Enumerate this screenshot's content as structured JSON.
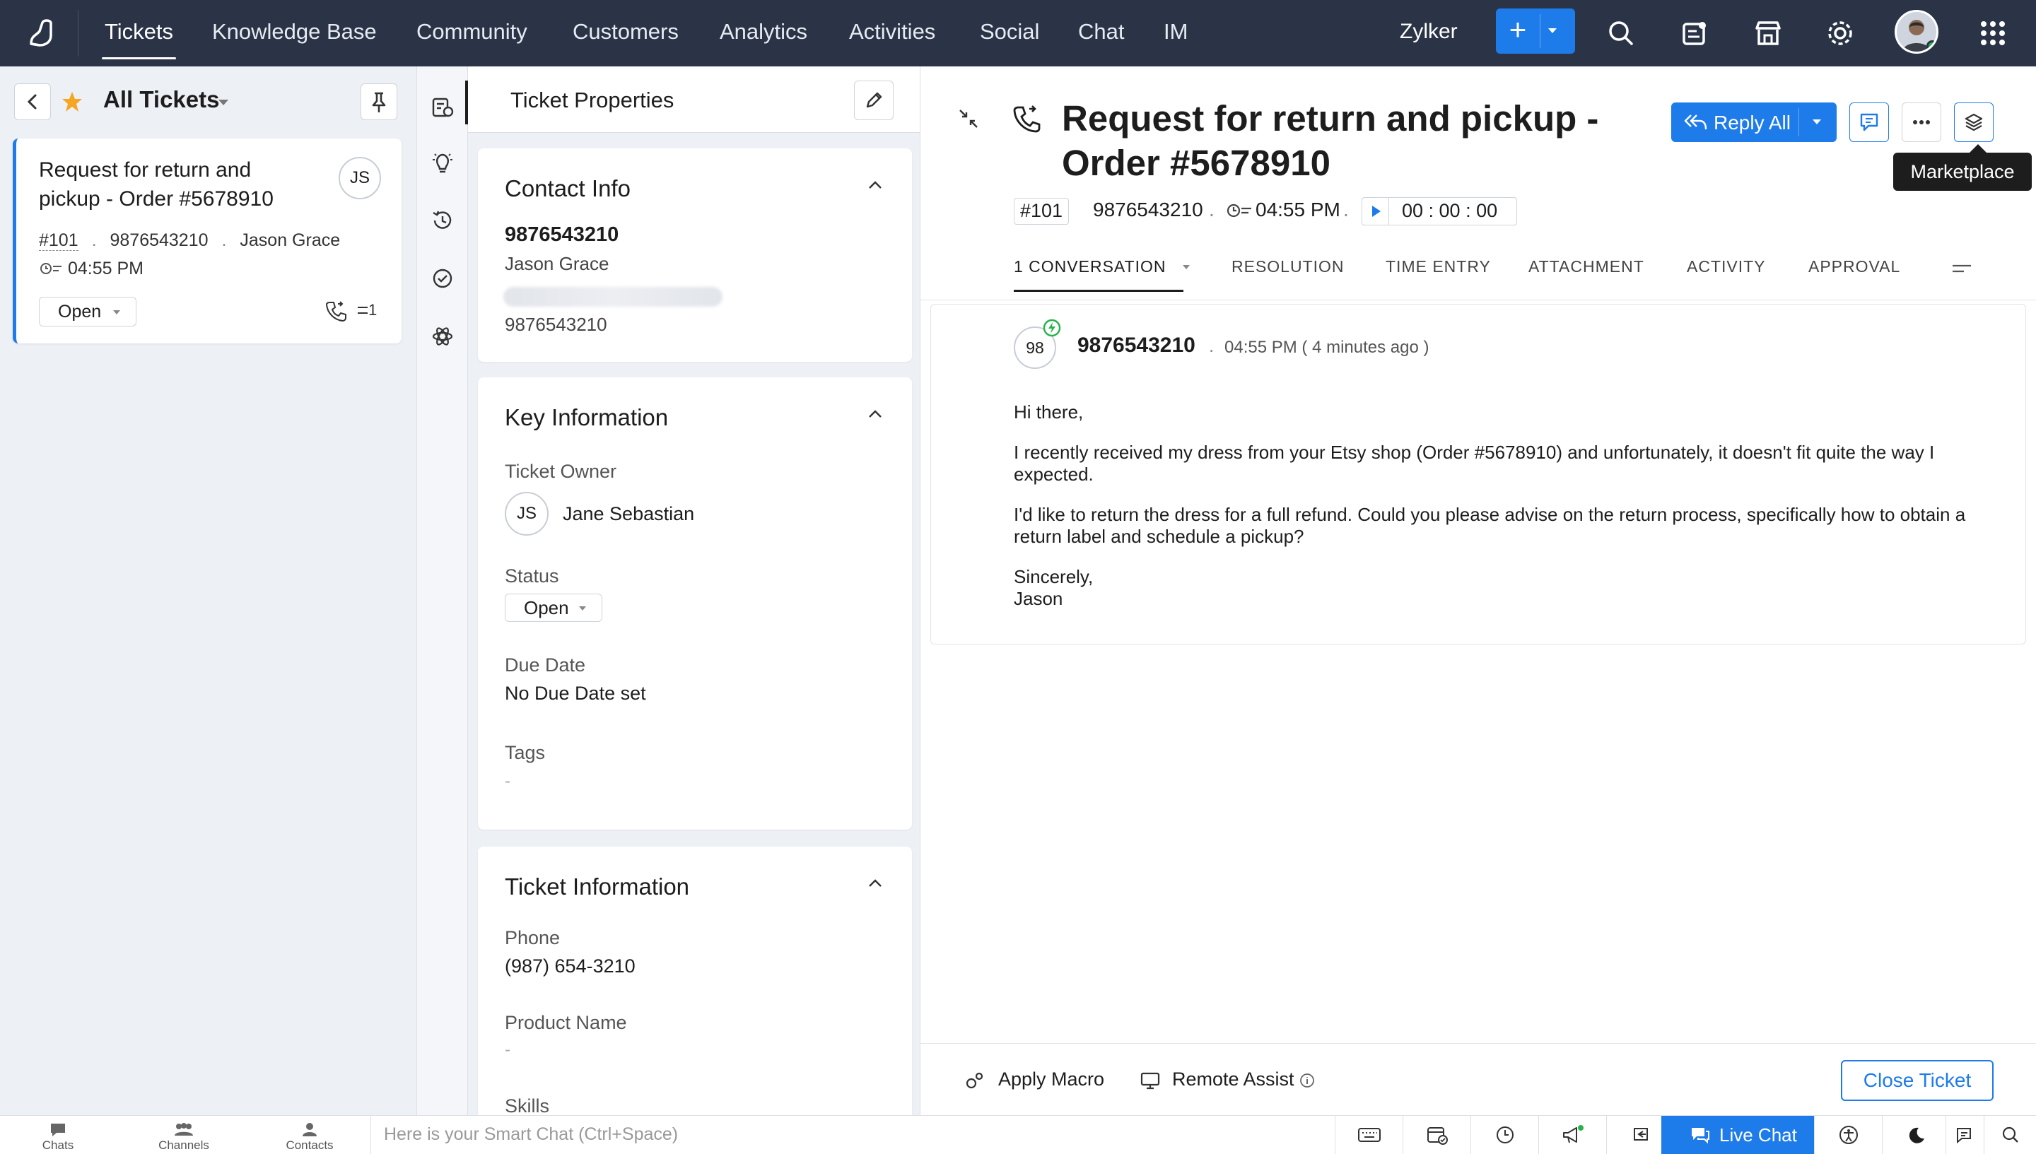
{
  "topnav": {
    "tabs": [
      "Tickets",
      "Knowledge Base",
      "Community",
      "Customers",
      "Analytics",
      "Activities",
      "Social",
      "Chat",
      "IM"
    ],
    "active": "Tickets",
    "org": "Zylker"
  },
  "leftpanel": {
    "view_title": "All Tickets",
    "card": {
      "subject": "Request for return and pickup - Order #5678910",
      "avatar": "JS",
      "id": "#101",
      "phone": "9876543210",
      "contact": "Jason Grace",
      "time": "04:55 PM",
      "status": "Open",
      "thread_count": "1"
    }
  },
  "props": {
    "title": "Ticket Properties",
    "contact_info": {
      "heading": "Contact Info",
      "name_primary": "9876543210",
      "name_secondary": "Jason Grace",
      "phone": "9876543210"
    },
    "key_info": {
      "heading": "Key Information",
      "owner_label": "Ticket Owner",
      "owner_initials": "JS",
      "owner_name": "Jane Sebastian",
      "status_label": "Status",
      "status": "Open",
      "due_label": "Due Date",
      "due_value": "No Due Date set",
      "tags_label": "Tags",
      "tags_value": "-"
    },
    "ticket_info": {
      "heading": "Ticket Information",
      "phone_label": "Phone",
      "phone_value": "(987) 654-3210",
      "product_label": "Product Name",
      "product_value": "-",
      "skills_label": "Skills"
    }
  },
  "ticket": {
    "subject_line1": "Request for return and pickup -",
    "subject_line2": "Order #5678910",
    "id": "#101",
    "phone": "9876543210",
    "time": "04:55 PM",
    "timer": "00 : 00 : 00",
    "reply_label": "Reply All",
    "tooltip": "Marketplace",
    "tabs": [
      "1 CONVERSATION",
      "RESOLUTION",
      "TIME ENTRY",
      "ATTACHMENT",
      "ACTIVITY",
      "APPROVAL"
    ],
    "conversation": {
      "avatar": "98",
      "from": "9876543210",
      "sent": "04:55 PM ( 4 minutes ago )",
      "greeting": "Hi there,",
      "p1": "I recently received my dress from your Etsy shop (Order #5678910) and unfortunately, it doesn't fit quite the way I expected.",
      "p2": "I'd like to return the dress for a full refund. Could you please advise on the return process, specifically how to obtain a return label and schedule a pickup?",
      "sign1": "Sincerely,",
      "sign2": "Jason"
    },
    "footer": {
      "macro": "Apply Macro",
      "remote": "Remote Assist",
      "close": "Close Ticket"
    }
  },
  "statusbar": {
    "chats": "Chats",
    "channels": "Channels",
    "contacts": "Contacts",
    "smartchat_placeholder": "Here is your Smart Chat (Ctrl+Space)",
    "livechat": "Live Chat"
  },
  "colors": {
    "topbar": "#2a3446",
    "accent": "#1e7bea",
    "star": "#f5a623",
    "online": "#27b24a"
  }
}
